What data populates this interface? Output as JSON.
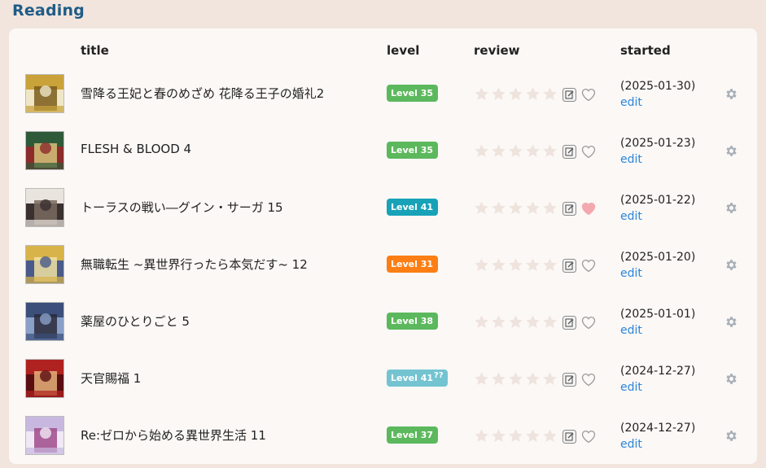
{
  "section": {
    "title": "Reading"
  },
  "columns": {
    "title": "title",
    "level": "level",
    "review": "review",
    "started": "started"
  },
  "rows": [
    {
      "title": "雪降る王妃と春のめざめ 花降る王子の婚礼2",
      "level": "Level 35",
      "level_note": "",
      "level_color": "#5cb85c",
      "liked": false,
      "started": "(2025-01-30)",
      "edit": "edit",
      "cover_colors": [
        "#c9a23a",
        "#efe6c8",
        "#7a5a1a"
      ]
    },
    {
      "title": "FLESH & BLOOD 4",
      "level": "Level 35",
      "level_note": "",
      "level_color": "#5cb85c",
      "liked": false,
      "started": "(2025-01-23)",
      "edit": "edit",
      "cover_colors": [
        "#2f5a3a",
        "#8c2b2b",
        "#d3c27a"
      ]
    },
    {
      "title": "トーラスの戦い―グイン・サーガ 15",
      "level": "Level 41",
      "level_note": "",
      "level_color": "#17a2b8",
      "liked": true,
      "started": "(2025-01-22)",
      "edit": "edit",
      "cover_colors": [
        "#e9e4de",
        "#3a3030",
        "#7a6a60"
      ]
    },
    {
      "title": "無職転生 ~異世界行ったら本気だす~ 12",
      "level": "Level 31",
      "level_note": "",
      "level_color": "#fd7e14",
      "liked": false,
      "started": "(2025-01-20)",
      "edit": "edit",
      "cover_colors": [
        "#d8b34a",
        "#4a5a8a",
        "#f1e2a2"
      ]
    },
    {
      "title": "薬屋のひとりごと 5",
      "level": "Level 38",
      "level_note": "",
      "level_color": "#5cb85c",
      "liked": false,
      "started": "(2025-01-01)",
      "edit": "edit",
      "cover_colors": [
        "#3b4f7a",
        "#8aa0c8",
        "#2a2a3a"
      ]
    },
    {
      "title": "天官賜福 1",
      "level": "Level 41",
      "level_note": "??",
      "level_color": "#74c3d1",
      "liked": false,
      "started": "(2024-12-27)",
      "edit": "edit",
      "cover_colors": [
        "#b0221f",
        "#5a0e12",
        "#e6b07a"
      ]
    },
    {
      "title": "Re:ゼロから始める異世界生活 11",
      "level": "Level 37",
      "level_note": "",
      "level_color": "#5cb85c",
      "liked": false,
      "started": "(2024-12-27)",
      "edit": "edit",
      "cover_colors": [
        "#c8b8e0",
        "#f0e8f4",
        "#a04a8a"
      ]
    }
  ],
  "icons": {
    "star": "star-icon",
    "review": "edit-review-icon",
    "like": "heart-icon",
    "settings": "gear-icon"
  },
  "colors": {
    "section_title": "#1f5c86",
    "star_empty": "#efe3de",
    "heart_outline": "#9a9a9a",
    "heart_filled": "#f4a8b0",
    "link": "#2b86d9",
    "gear": "#a9b0b8"
  }
}
